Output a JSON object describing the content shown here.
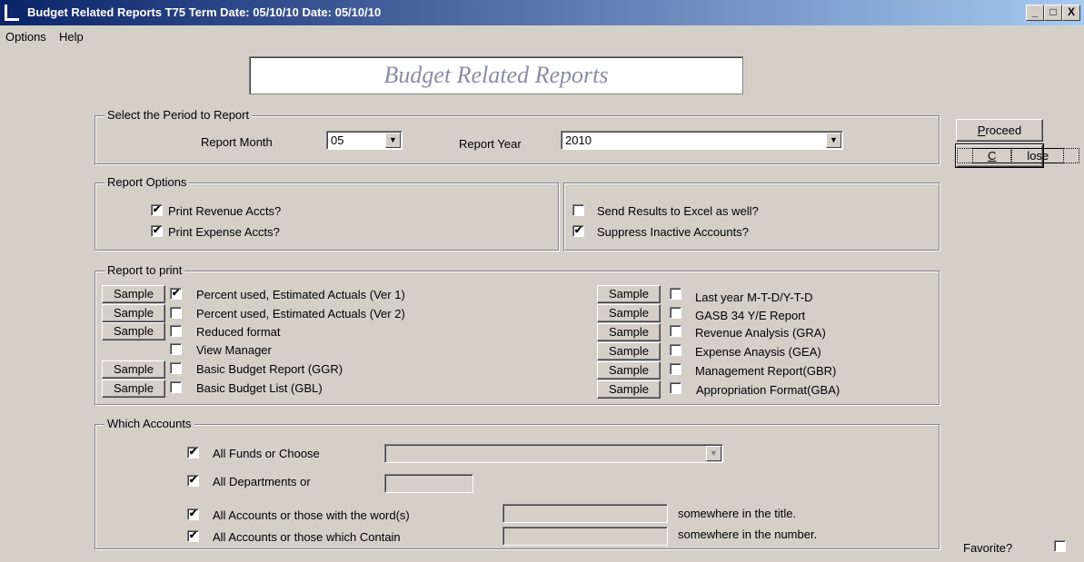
{
  "window": {
    "title": "Budget Related Reports   T75  Term Date: 05/10/10  Date: 05/10/10",
    "minimize": "_",
    "maximize": "□",
    "close": "X"
  },
  "menu": {
    "options": "Options",
    "help": "Help"
  },
  "banner": "Budget Related Reports",
  "period": {
    "legend": "Select the Period to Report",
    "month_label": "Report Month",
    "month_value": "05",
    "year_label": "Report Year",
    "year_value": "2010"
  },
  "buttons": {
    "proceed": "Proceed",
    "close": "Close"
  },
  "options": {
    "legend": "Report Options",
    "print_revenue": "Print Revenue Accts?",
    "print_expense": "Print Expense Accts?",
    "send_excel": "Send Results to Excel as well?",
    "suppress_inactive": "Suppress Inactive Accounts?"
  },
  "reports": {
    "legend": "Report to print",
    "sample_label": "Sample",
    "left": [
      "Percent used,  Estimated Actuals (Ver 1)",
      "Percent used,  Estimated Actuals (Ver 2)",
      "Reduced format",
      "View Manager",
      "Basic Budget Report (GGR)",
      "Basic Budget List (GBL)"
    ],
    "right": [
      "Last year M-T-D/Y-T-D",
      "GASB 34 Y/E Report",
      "Revenue Analysis (GRA)",
      "Expense Anaysis (GEA)",
      "Management Report(GBR)",
      "Appropriation Format(GBA)"
    ]
  },
  "accounts": {
    "legend": "Which Accounts",
    "all_funds": "All Funds or Choose",
    "all_departments": "All Departments or",
    "all_accounts_word": "All Accounts or those with the word(s)",
    "suffix_title": "somewhere in the title.",
    "all_accounts_contain": "All Accounts or those which Contain",
    "suffix_number": "somewhere in the number."
  },
  "favorite": "Favorite?",
  "check_mark": "✔"
}
